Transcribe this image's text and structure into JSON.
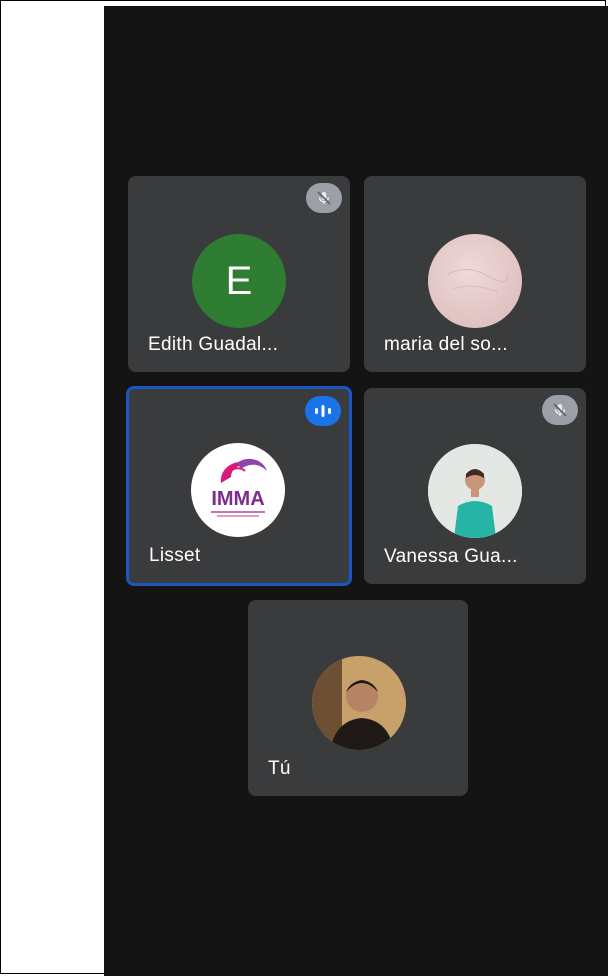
{
  "participants": [
    {
      "name": "Edith Guadal...",
      "initial": "E",
      "avatar_color": "#2e7d32",
      "mic": "muted"
    },
    {
      "name": "maria del so...",
      "avatar_color": "#e3c7c7",
      "mic": "none"
    },
    {
      "name": "Lisset",
      "logo_text": "IMMA",
      "mic": "speaking",
      "active": true
    },
    {
      "name": "Vanessa Gua...",
      "mic": "muted"
    },
    {
      "name": "Tú",
      "mic": "none"
    }
  ],
  "colors": {
    "stage_bg": "#141414",
    "tile_bg": "#3a3b3d",
    "active_border": "#1a56c4",
    "speaking": "#1a73e8",
    "muted_badge": "#9aa0a6"
  }
}
